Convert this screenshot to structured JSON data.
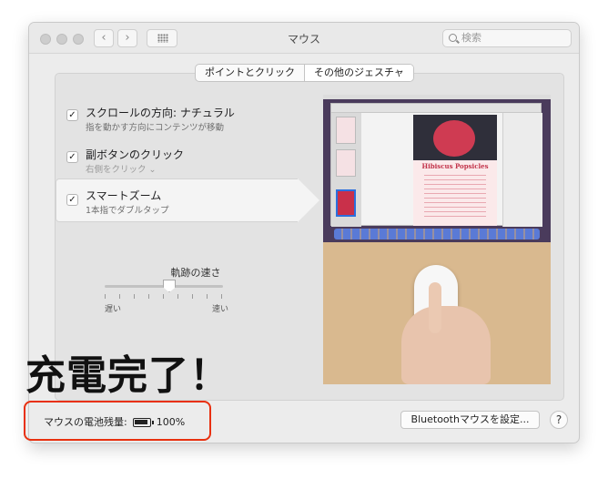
{
  "window": {
    "title": "マウス",
    "search_placeholder": "検索",
    "back_label": "‹",
    "forward_label": "›"
  },
  "tabs": [
    {
      "label": "ポイントとクリック",
      "active": false
    },
    {
      "label": "その他のジェスチャ",
      "active": true
    }
  ],
  "options": [
    {
      "title": "スクロールの方向: ナチュラル",
      "subtitle": "指を動かす方向にコンテンツが移動",
      "checked": true
    },
    {
      "title": "副ボタンのクリック",
      "subtitle": "右側をクリック ⌄",
      "checked": true
    },
    {
      "title": "スマートズーム",
      "subtitle": "1本指でダブルタップ",
      "checked": true
    }
  ],
  "checkmark": "✓",
  "tracking": {
    "label": "軌跡の速さ",
    "min_label": "遅い",
    "max_label": "速い",
    "value_fraction": 0.5
  },
  "preview": {
    "doc_title": "Hibiscus Popsicles"
  },
  "overlay_caption": "充電完了！",
  "battery": {
    "label": "マウスの電池残量:",
    "value": "100%"
  },
  "bluetooth_button": "Bluetoothマウスを設定...",
  "help_label": "?",
  "colors": {
    "highlight": "#e8300f",
    "window_bg": "#ececec"
  }
}
